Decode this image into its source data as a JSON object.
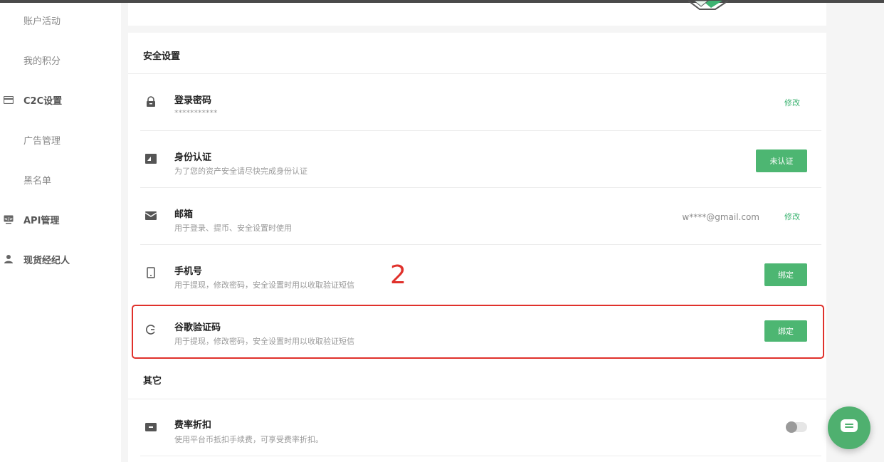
{
  "sidebar": {
    "items": [
      {
        "label": "账户活动"
      },
      {
        "label": "我的积分"
      },
      {
        "label": "C2C设置",
        "icon": "card-icon"
      },
      {
        "label": "广告管理"
      },
      {
        "label": "黑名单"
      },
      {
        "label": "API管理",
        "icon": "api-icon"
      },
      {
        "label": "现货经纪人",
        "icon": "user-icon"
      }
    ]
  },
  "security": {
    "title": "安全设置",
    "rows": [
      {
        "title": "登录密码",
        "desc": "***********",
        "action": "修改",
        "icon": "lock-icon"
      },
      {
        "title": "身份认证",
        "desc": "为了您的资产安全请尽快完成身份认证",
        "action": "未认证",
        "icon": "id-card-icon"
      },
      {
        "title": "邮箱",
        "desc": "用于登录、提币、安全设置时使用",
        "value": "w****@gmail.com",
        "action": "修改",
        "icon": "mail-icon"
      },
      {
        "title": "手机号",
        "desc": "用于提现，修改密码，安全设置时用以收取验证短信",
        "action": "绑定",
        "icon": "phone-icon"
      },
      {
        "title": "谷歌验证码",
        "desc": "用于提现，修改密码，安全设置时用以收取验证短信",
        "action": "绑定",
        "icon": "google-icon"
      }
    ]
  },
  "other": {
    "title": "其它",
    "rows": [
      {
        "title": "费率折扣",
        "desc": "使用平台币抵扣手续费，可享受费率折扣。",
        "toggle": false,
        "icon": "discount-icon"
      }
    ]
  },
  "annotation": {
    "number": "2",
    "color": "#e0312b"
  },
  "colors": {
    "accent": "#4db672",
    "highlight": "#e0312b"
  }
}
